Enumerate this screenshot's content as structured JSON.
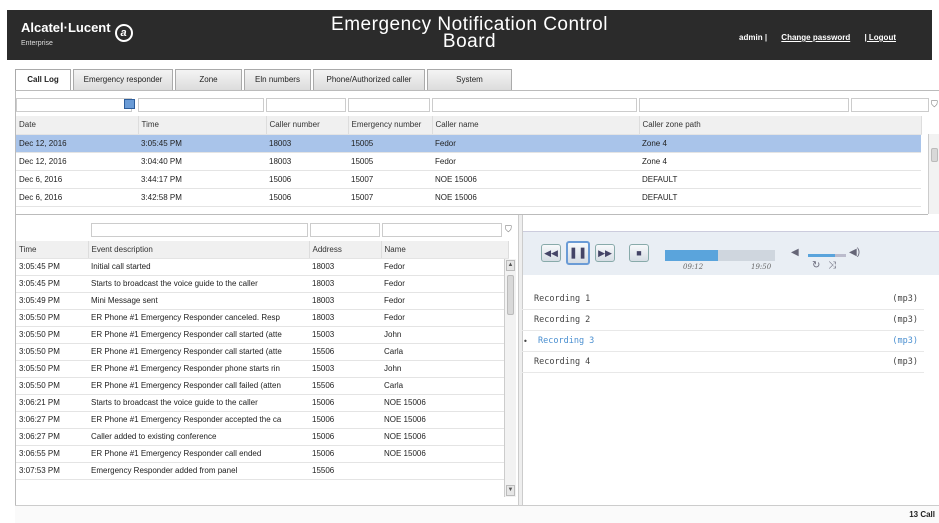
{
  "header": {
    "brand": "Alcatel·Lucent",
    "brand_sub": "Enterprise",
    "title_line1": "Emergency Notification Control",
    "title_line2": "Board",
    "user": "admin |",
    "change_password": "Change password",
    "logout": "| Logout",
    "logo_glyph": "a"
  },
  "tabs": [
    "Call Log",
    "Emergency responder",
    "Zone",
    "Eln numbers",
    "Phone/Authorized caller",
    "System"
  ],
  "call_table": {
    "columns": [
      "Date",
      "Time",
      "Caller number",
      "Emergency number",
      "Caller name",
      "Caller zone path"
    ],
    "rows": [
      [
        "Dec 12, 2016",
        "3:05:45 PM",
        "18003",
        "15005",
        "Fedor",
        "Zone 4"
      ],
      [
        "Dec 12, 2016",
        "3:04:40 PM",
        "18003",
        "15005",
        "Fedor",
        "Zone 4"
      ],
      [
        "Dec 6, 2016",
        "3:44:17 PM",
        "15006",
        "15007",
        "NOE 15006",
        "DEFAULT"
      ],
      [
        "Dec 6, 2016",
        "3:42:58 PM",
        "15006",
        "15007",
        "NOE 15006",
        "DEFAULT"
      ]
    ]
  },
  "event_table": {
    "columns": [
      "Time",
      "Event description",
      "Address",
      "Name"
    ],
    "rows": [
      [
        "3:05:45 PM",
        "Initial call started",
        "18003",
        "Fedor"
      ],
      [
        "3:05:45 PM",
        "Starts to broadcast the voice guide to the caller",
        "18003",
        "Fedor"
      ],
      [
        "3:05:49 PM",
        "Mini Message sent",
        "18003",
        "Fedor"
      ],
      [
        "3:05:50 PM",
        "ER Phone #1 Emergency Responder canceled. Resp",
        "18003",
        "Fedor"
      ],
      [
        "3:05:50 PM",
        "ER Phone #1 Emergency Responder call started (atte",
        "15003",
        "John"
      ],
      [
        "3:05:50 PM",
        "ER Phone #1 Emergency Responder call started (atte",
        "15506",
        "Carla"
      ],
      [
        "3:05:50 PM",
        "ER Phone #1 Emergency Responder phone starts rin",
        "15003",
        "John"
      ],
      [
        "3:05:50 PM",
        "ER Phone #1 Emergency Responder call failed (atten",
        "15506",
        "Carla"
      ],
      [
        "3:06:21 PM",
        "Starts to broadcast the voice guide to the caller",
        "15006",
        "NOE 15006"
      ],
      [
        "3:06:27 PM",
        "ER Phone #1 Emergency Responder accepted the ca",
        "15006",
        "NOE 15006"
      ],
      [
        "3:06:27 PM",
        "Caller added to existing conference",
        "15006",
        "NOE 15006"
      ],
      [
        "3:06:55 PM",
        "ER Phone #1 Emergency Responder call ended",
        "15006",
        "NOE 15006"
      ],
      [
        "3:07:53 PM",
        "Emergency Responder added from panel",
        "15506",
        ""
      ]
    ]
  },
  "player": {
    "elapsed": "09:12",
    "duration": "19:50",
    "progress": 0.48,
    "volume": 0.7,
    "icons": [
      "rewind-icon",
      "pause-icon",
      "fast-forward-icon",
      "stop-icon",
      "mute-icon",
      "volume-icon",
      "repeat-icon",
      "shuffle-icon"
    ]
  },
  "recordings": [
    {
      "name": "Recording 1",
      "format": "(mp3)"
    },
    {
      "name": "Recording 2",
      "format": "(mp3)"
    },
    {
      "name": "Recording 3",
      "format": "(mp3)",
      "bullet": "•"
    },
    {
      "name": "Recording 4",
      "format": "(mp3)"
    }
  ],
  "footer": {
    "count": "13 Call"
  },
  "colors": {
    "header_bg": "#2b2b2b",
    "selected_row": "#a9c4ea",
    "accent": "#5aa4dc"
  }
}
